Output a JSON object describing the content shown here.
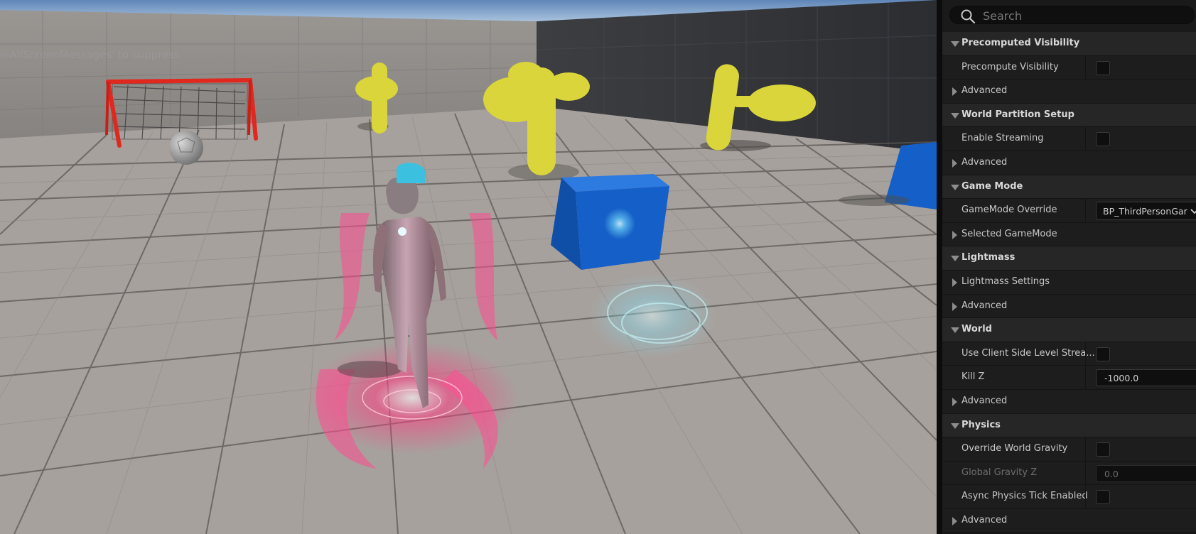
{
  "viewport": {
    "screen_message": "leAllScreenMessages' to suppress"
  },
  "details": {
    "search_placeholder": "Search",
    "rows": [
      {
        "kind": "category",
        "label": "Precomputed Visibility",
        "expanded": true
      },
      {
        "kind": "property",
        "label": "Precompute Visibility",
        "control": "checkbox",
        "checked": false
      },
      {
        "kind": "subgroup",
        "label": "Advanced",
        "expanded": false
      },
      {
        "kind": "category",
        "label": "World Partition Setup",
        "expanded": true
      },
      {
        "kind": "property",
        "label": "Enable Streaming",
        "control": "checkbox",
        "checked": false
      },
      {
        "kind": "subgroup",
        "label": "Advanced",
        "expanded": false
      },
      {
        "kind": "category",
        "label": "Game Mode",
        "expanded": true
      },
      {
        "kind": "property",
        "label": "GameMode Override",
        "control": "combo",
        "value": "BP_ThirdPersonGar"
      },
      {
        "kind": "subgroup",
        "label": "Selected GameMode",
        "expanded": false
      },
      {
        "kind": "category",
        "label": "Lightmass",
        "expanded": true
      },
      {
        "kind": "subgroup",
        "label": "Lightmass Settings",
        "expanded": false
      },
      {
        "kind": "subgroup",
        "label": "Advanced",
        "expanded": false
      },
      {
        "kind": "category",
        "label": "World",
        "expanded": true
      },
      {
        "kind": "property",
        "label": "Use Client Side Level Strea...",
        "control": "checkbox",
        "checked": false
      },
      {
        "kind": "property",
        "label": "Kill Z",
        "control": "number",
        "value": "-1000.0"
      },
      {
        "kind": "subgroup",
        "label": "Advanced",
        "expanded": false
      },
      {
        "kind": "category",
        "label": "Physics",
        "expanded": true
      },
      {
        "kind": "property",
        "label": "Override World Gravity",
        "control": "checkbox",
        "checked": false
      },
      {
        "kind": "property",
        "label": "Global Gravity Z",
        "control": "number",
        "value": "0.0",
        "disabled": true
      },
      {
        "kind": "property",
        "label": "Async Physics Tick Enabled",
        "control": "checkbox",
        "checked": false
      },
      {
        "kind": "subgroup",
        "label": "Advanced",
        "expanded": false
      }
    ]
  },
  "colors": {
    "panel_bg": "#1a1a1a",
    "category_bg": "#262626",
    "goal_red": "#e0281e",
    "prop_yellow": "#d9d53a",
    "cube_blue": "#1560c8",
    "character_fx_pink": "#ff3c82",
    "portal_cyan": "#8ff0ff"
  }
}
